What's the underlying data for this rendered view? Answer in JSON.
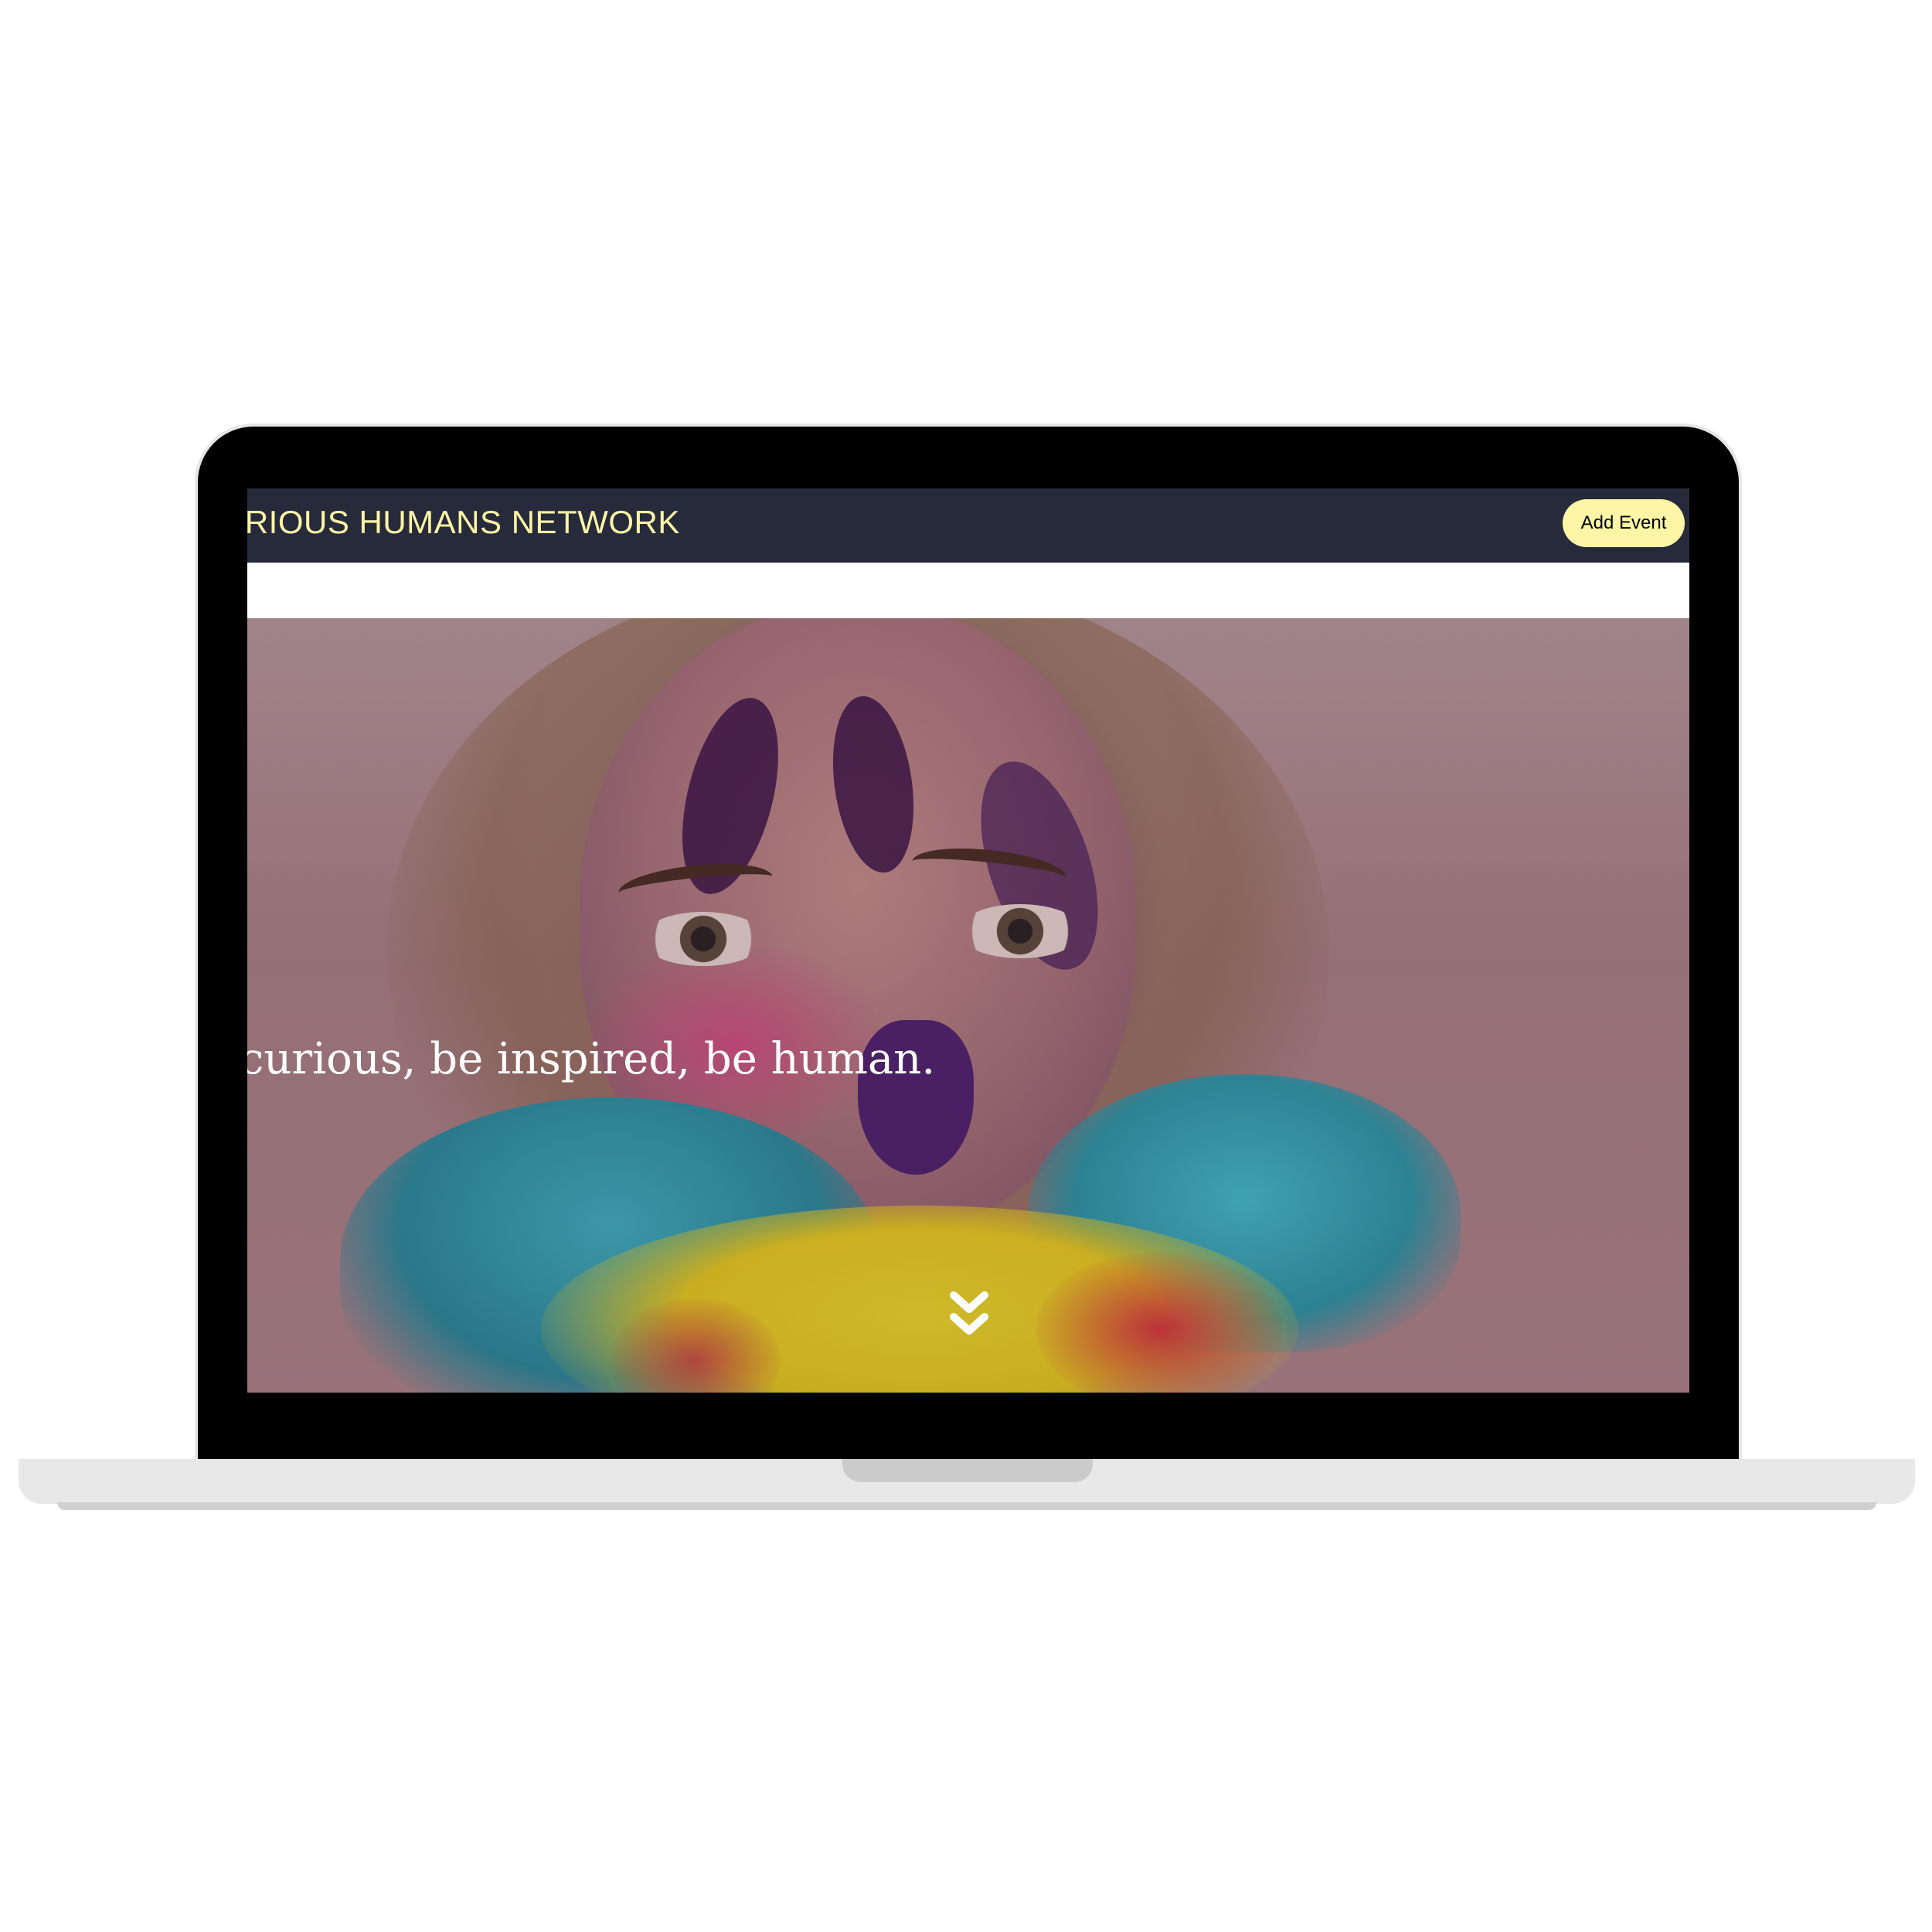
{
  "header": {
    "brand": "URIOUS HUMANS NETWORK",
    "add_event_label": "Add Event"
  },
  "hero": {
    "tagline": "curious, be inspired, be human.",
    "scroll_icon": "chevron-double-down-icon",
    "image_subject": "woman-with-colour-powder"
  },
  "colors": {
    "navbar_bg": "#272a3a",
    "brand_text": "#fdf6a6",
    "button_bg": "#fdf6a6",
    "tagline_text": "#ffffff"
  }
}
